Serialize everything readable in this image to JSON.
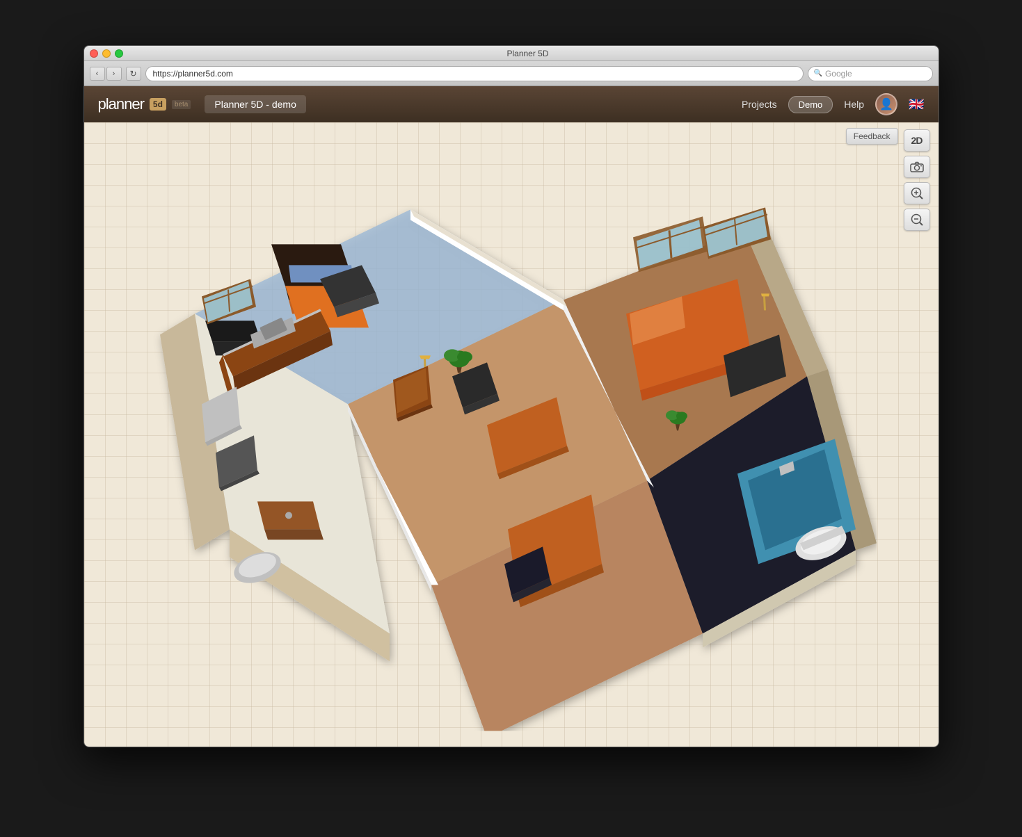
{
  "window": {
    "title": "Planner 5D",
    "url": "https://planner5d.com",
    "search_placeholder": "Google"
  },
  "header": {
    "logo_text": "planner",
    "logo_badge": "5d",
    "beta_label": "beta",
    "project_name": "Planner 5D - demo",
    "nav": {
      "projects": "Projects",
      "demo": "Demo",
      "help": "Help"
    }
  },
  "toolbar": {
    "view_2d": "2D",
    "camera_icon": "📷",
    "zoom_in_icon": "🔍+",
    "zoom_out_icon": "🔍-",
    "feedback_label": "Feedback"
  },
  "traffic_lights": {
    "close": "close",
    "minimize": "minimize",
    "maximize": "maximize"
  },
  "nav_buttons": {
    "back": "‹",
    "forward": "›",
    "reload": "↻"
  }
}
